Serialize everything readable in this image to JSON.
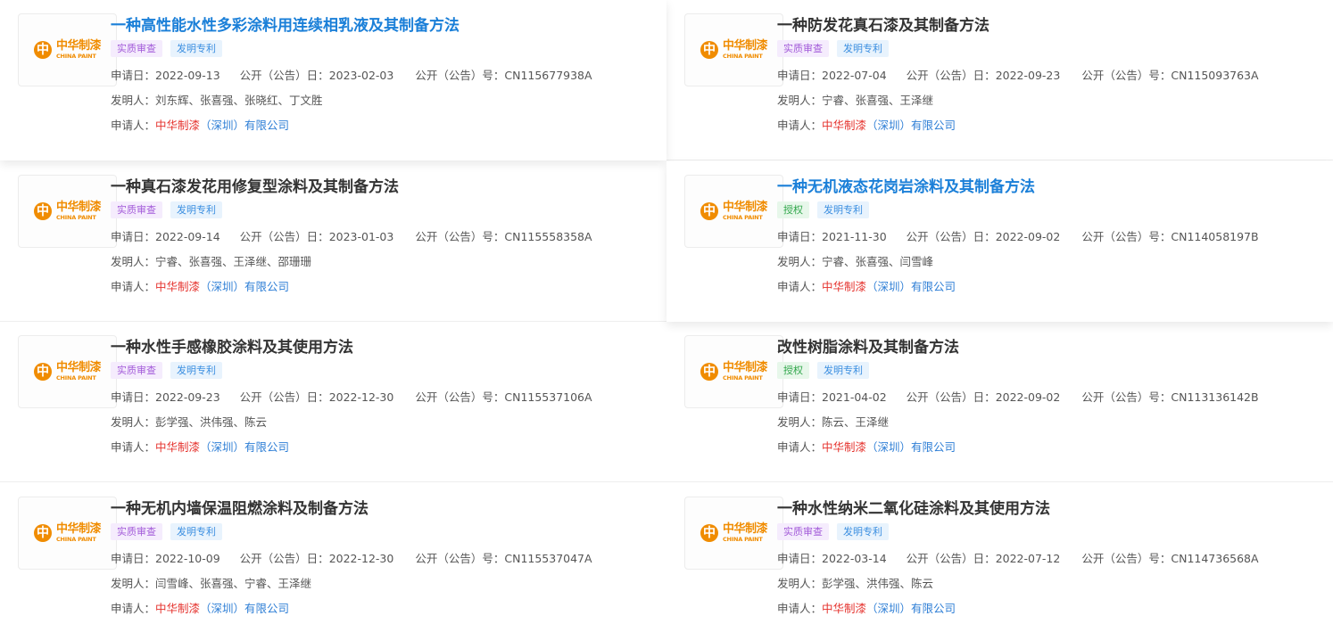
{
  "labels": {
    "apply_date": "申请日：",
    "pub_date": "公开（公告）日：",
    "pub_no": "公开（公告）号：",
    "inventors": "发明人：",
    "applicant": "申请人："
  },
  "logo": {
    "mark": "中",
    "cn_text": "中华制漆",
    "en_text": "CHINA PAINT"
  },
  "applicant": {
    "red": "中华制漆",
    "blue": "（深圳）有限公司"
  },
  "colors": {
    "title_active": "#1a7fd8",
    "title_default": "#333333",
    "applicant_red": "#e5322d",
    "applicant_blue": "#2f7fd6",
    "tag_review": "#a35bd9",
    "tag_granted": "#30a64b",
    "tag_invention": "#3a8ee0",
    "logo_orange": "#f08c00"
  },
  "patents": [
    {
      "title": "一种高性能水性多彩涂料用连续相乳液及其制备方法",
      "status": "实质审查",
      "status_type": "review",
      "kind": "发明专利",
      "apply_date": "2022-09-13",
      "pub_date": "2023-02-03",
      "pub_no": "CN115677938A",
      "inventors": "刘东辉、张喜强、张晓红、丁文胜",
      "highlighted": true
    },
    {
      "title": "一种防发花真石漆及其制备方法",
      "status": "实质审查",
      "status_type": "review",
      "kind": "发明专利",
      "apply_date": "2022-07-04",
      "pub_date": "2022-09-23",
      "pub_no": "CN115093763A",
      "inventors": "宁睿、张喜强、王泽继",
      "highlighted": false
    },
    {
      "title": "一种真石漆发花用修复型涂料及其制备方法",
      "status": "实质审查",
      "status_type": "review",
      "kind": "发明专利",
      "apply_date": "2022-09-14",
      "pub_date": "2023-01-03",
      "pub_no": "CN115558358A",
      "inventors": "宁睿、张喜强、王泽继、邵珊珊",
      "highlighted": false
    },
    {
      "title": "一种无机液态花岗岩涂料及其制备方法",
      "status": "授权",
      "status_type": "granted",
      "kind": "发明专利",
      "apply_date": "2021-11-30",
      "pub_date": "2022-09-02",
      "pub_no": "CN114058197B",
      "inventors": "宁睿、张喜强、闫雪峰",
      "highlighted": true
    },
    {
      "title": "一种水性手感橡胶涂料及其使用方法",
      "status": "实质审查",
      "status_type": "review",
      "kind": "发明专利",
      "apply_date": "2022-09-23",
      "pub_date": "2022-12-30",
      "pub_no": "CN115537106A",
      "inventors": "彭学强、洪伟强、陈云",
      "highlighted": false
    },
    {
      "title": "改性树脂涂料及其制备方法",
      "status": "授权",
      "status_type": "granted",
      "kind": "发明专利",
      "apply_date": "2021-04-02",
      "pub_date": "2022-09-02",
      "pub_no": "CN113136142B",
      "inventors": "陈云、王泽继",
      "highlighted": false
    },
    {
      "title": "一种无机内墙保温阻燃涂料及制备方法",
      "status": "实质审查",
      "status_type": "review",
      "kind": "发明专利",
      "apply_date": "2022-10-09",
      "pub_date": "2022-12-30",
      "pub_no": "CN115537047A",
      "inventors": "闫雪峰、张喜强、宁睿、王泽继",
      "highlighted": false
    },
    {
      "title": "一种水性纳米二氧化硅涂料及其使用方法",
      "status": "实质审查",
      "status_type": "review",
      "kind": "发明专利",
      "apply_date": "2022-03-14",
      "pub_date": "2022-07-12",
      "pub_no": "CN114736568A",
      "inventors": "彭学强、洪伟强、陈云",
      "highlighted": false
    }
  ]
}
